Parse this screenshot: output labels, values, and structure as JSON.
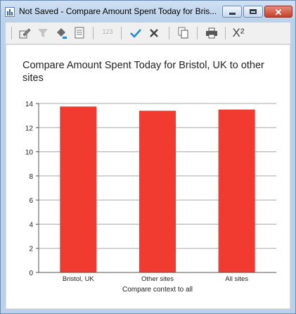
{
  "window": {
    "title": "Not Saved - Compare Amount Spent Today for Bris...",
    "app_icon": "bar-chart-icon"
  },
  "toolbar": {
    "buttons": [
      {
        "icon": "edit-icon"
      },
      {
        "icon": "filter-icon",
        "disabled": true
      },
      {
        "icon": "paint-bucket-icon"
      },
      {
        "icon": "document-icon"
      },
      {
        "icon": "number-format-icon",
        "label": "123",
        "disabled": true
      },
      {
        "icon": "check-icon"
      },
      {
        "icon": "x-icon"
      },
      {
        "icon": "copy-icon"
      },
      {
        "icon": "print-icon"
      },
      {
        "icon": "formula-icon",
        "label": "X²"
      }
    ],
    "check_color": "#1e8bd7"
  },
  "chart_data": {
    "type": "bar",
    "title": "Compare Amount Spent Today for Bristol, UK to other sites",
    "xlabel": "Compare context to all",
    "ylabel": "",
    "categories": [
      "Bristol, UK",
      "Other sites",
      "All sites"
    ],
    "values": [
      13.75,
      13.4,
      13.5
    ],
    "ylim": [
      0,
      14
    ],
    "yticks": [
      0,
      2,
      4,
      6,
      8,
      10,
      12,
      14
    ],
    "grid": true,
    "bar_color": "#f23b30"
  }
}
